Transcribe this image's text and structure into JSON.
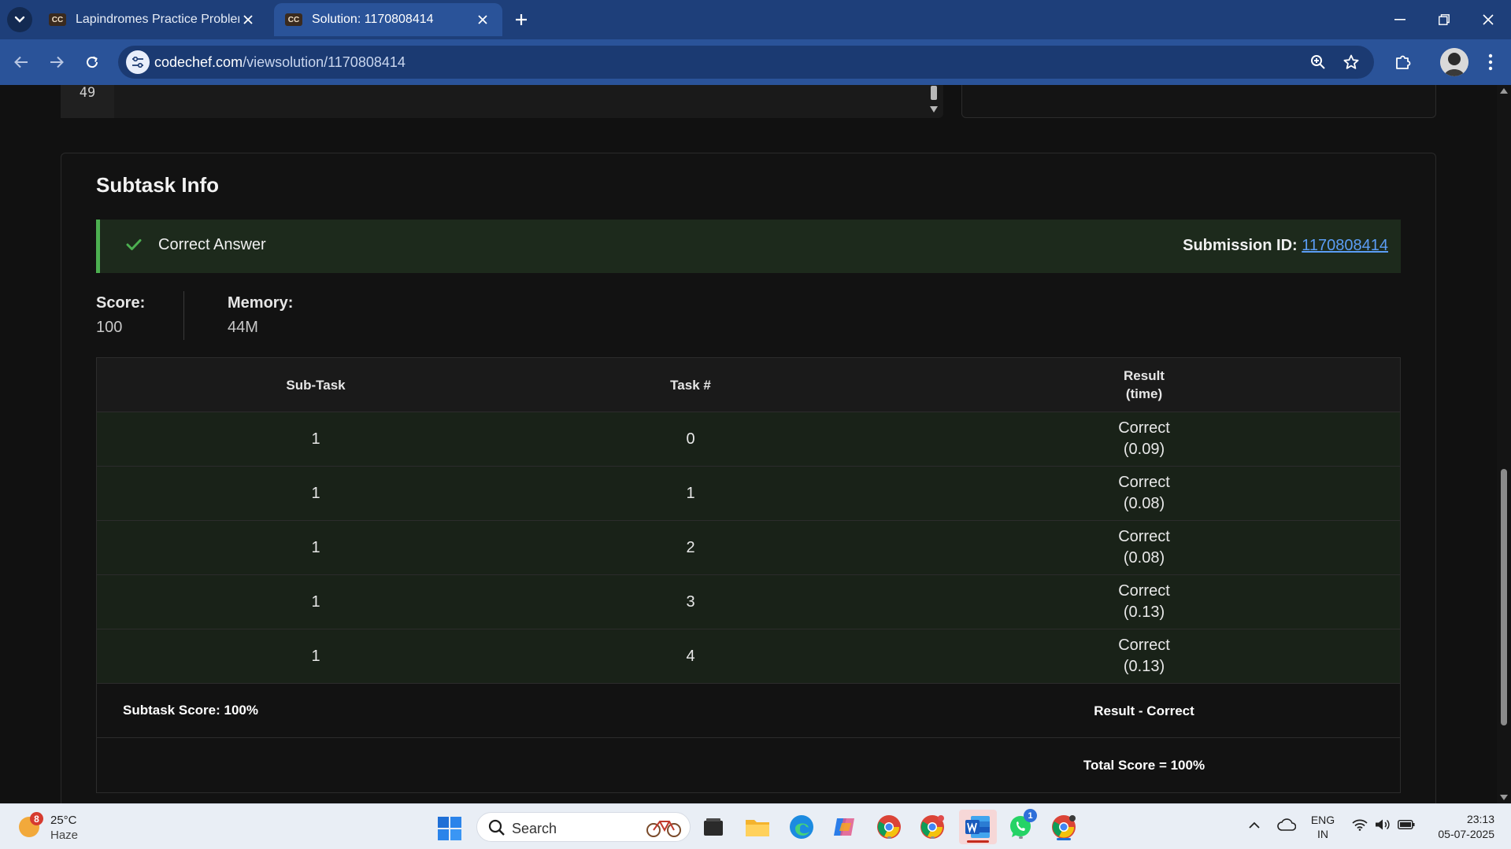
{
  "browser": {
    "tabs": [
      {
        "title": "Lapindromes Practice Problem i",
        "favicon": "CC",
        "active": false
      },
      {
        "title": "Solution: 1170808414",
        "favicon": "CC",
        "active": true
      }
    ],
    "url_host": "codechef.com",
    "url_path": "/viewsolution/1170808414"
  },
  "code": {
    "last_line_number": "49"
  },
  "subtask": {
    "heading": "Subtask Info",
    "status": "Correct Answer",
    "submission_label": "Submission ID:",
    "submission_id": "1170808414",
    "score_label": "Score:",
    "score_value": "100",
    "memory_label": "Memory:",
    "memory_value": "44M",
    "columns": [
      "Sub-Task",
      "Task #",
      "Result",
      "(time)"
    ],
    "rows": [
      {
        "subtask": "1",
        "task": "0",
        "result": "Correct",
        "time": "(0.09)"
      },
      {
        "subtask": "1",
        "task": "1",
        "result": "Correct",
        "time": "(0.08)"
      },
      {
        "subtask": "1",
        "task": "2",
        "result": "Correct",
        "time": "(0.08)"
      },
      {
        "subtask": "1",
        "task": "3",
        "result": "Correct",
        "time": "(0.13)"
      },
      {
        "subtask": "1",
        "task": "4",
        "result": "Correct",
        "time": "(0.13)"
      }
    ],
    "subtask_score": "Subtask Score: 100%",
    "result_summary": "Result - Correct",
    "total_score": "Total Score = 100%"
  },
  "taskbar": {
    "weather_temp": "25°C",
    "weather_condition": "Haze",
    "weather_badge": "8",
    "search_placeholder": "Search",
    "whatsapp_badge": "1",
    "language_top": "ENG",
    "language_bottom": "IN",
    "time": "23:13",
    "date": "05-07-2025"
  },
  "colors": {
    "tab_strip": "#1e3f7a",
    "toolbar": "#2a5399",
    "page_background": "#111111",
    "success_green": "#4caf50",
    "row_background": "#192218",
    "link_blue": "#5b9df5"
  }
}
